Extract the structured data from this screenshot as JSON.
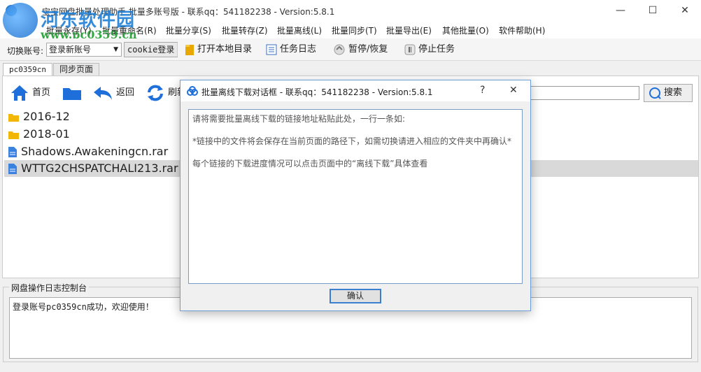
{
  "window": {
    "title": "宝宝网盘批量处理助手 批量多账号版 - 联系qq：541182238 - Version:5.8.1",
    "minimize": "—",
    "maximize": "☐",
    "close": "✕"
  },
  "watermark": {
    "text": "河东软件园",
    "url": "www.pc0359.cn"
  },
  "menu": {
    "items": [
      "批量永存(Y)",
      "批量重命名(R)",
      "批量分享(S)",
      "批量转存(Z)",
      "批量离线(L)",
      "批量同步(T)",
      "批量导出(E)",
      "其他批量(O)",
      "软件帮助(H)"
    ]
  },
  "toolbar": {
    "switch_label": "切换账号:",
    "account_select": "登录新账号",
    "cookie_login": "cookie登录",
    "open_local": "打开本地目录",
    "task_log": "任务日志",
    "pause_resume": "暂停/恢复",
    "stop_task": "停止任务"
  },
  "tabs": [
    "pc0359cn",
    "同步页面"
  ],
  "nav": {
    "home": "首页",
    "back": "返回",
    "refresh": "刷新",
    "search_button": "搜索",
    "search_value": ""
  },
  "files": [
    {
      "name": "2016-12",
      "type": "folder"
    },
    {
      "name": "2018-01",
      "type": "folder"
    },
    {
      "name": "Shadows.Awakeningcn.rar",
      "type": "file"
    },
    {
      "name": "WTTG2CHSPATCHALI213.rar",
      "type": "file"
    }
  ],
  "log": {
    "title": "网盘操作日志控制台",
    "text": "登录账号pc0359cn成功，欢迎使用！"
  },
  "dialog": {
    "title": "批量离线下载对话框 - 联系qq：541182238 - Version:5.8.1",
    "help": "?",
    "close": "✕",
    "lines": [
      "请将需要批量离线下载的链接地址粘贴此处，一行一条如:",
      "*链接中的文件将会保存在当前页面的路径下，如需切换请进入相应的文件夹中再确认*",
      "每个链接的下载进度情况可以点击页面中的“离线下载”具体查看"
    ],
    "ok": "确认"
  },
  "colors": {
    "accent": "#1e6fd9",
    "folder": "#f2b705",
    "file": "#3b82e0",
    "selected": "#d9d9d9"
  }
}
